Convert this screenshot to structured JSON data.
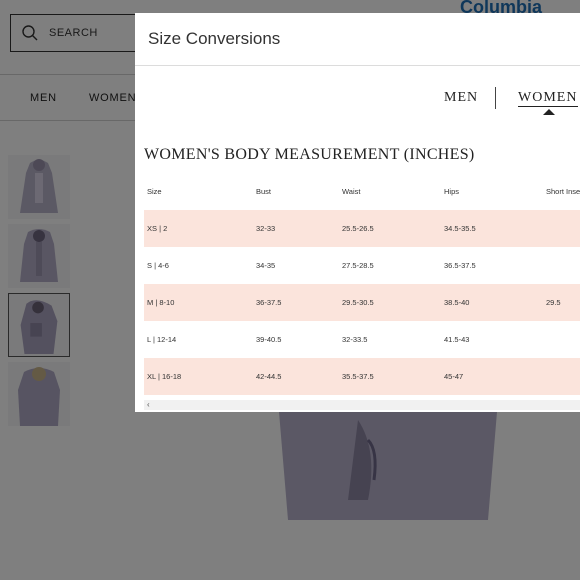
{
  "page": {
    "search_placeholder": "SEARCH",
    "logo_text": "Columbia",
    "nav_items": [
      "MEN",
      "WOMEN"
    ],
    "icons": {
      "search": "search-icon"
    }
  },
  "modal": {
    "title": "Size Conversions",
    "tabs": [
      {
        "label": "MEN",
        "active": false
      },
      {
        "label": "WOMEN",
        "active": true
      }
    ],
    "heading": "WOMEN'S BODY MEASUREMENT (INCHES)",
    "columns": [
      "Size",
      "Bust",
      "Waist",
      "Hips",
      "Short Inseam"
    ],
    "rows": [
      [
        "XS | 2",
        "32-33",
        "25.5-26.5",
        "34.5-35.5",
        ""
      ],
      [
        "S | 4-6",
        "34-35",
        "27.5-28.5",
        "36.5-37.5",
        ""
      ],
      [
        "M | 8-10",
        "36-37.5",
        "29.5-30.5",
        "38.5-40",
        "29.5"
      ],
      [
        "L | 12-14",
        "39-40.5",
        "32-33.5",
        "41.5-43",
        ""
      ],
      [
        "XL | 16-18",
        "42-44.5",
        "35.5-37.5",
        "45-47",
        ""
      ]
    ],
    "scroll_left_glyph": "‹",
    "row_shade_color": "#fbe4dc"
  }
}
